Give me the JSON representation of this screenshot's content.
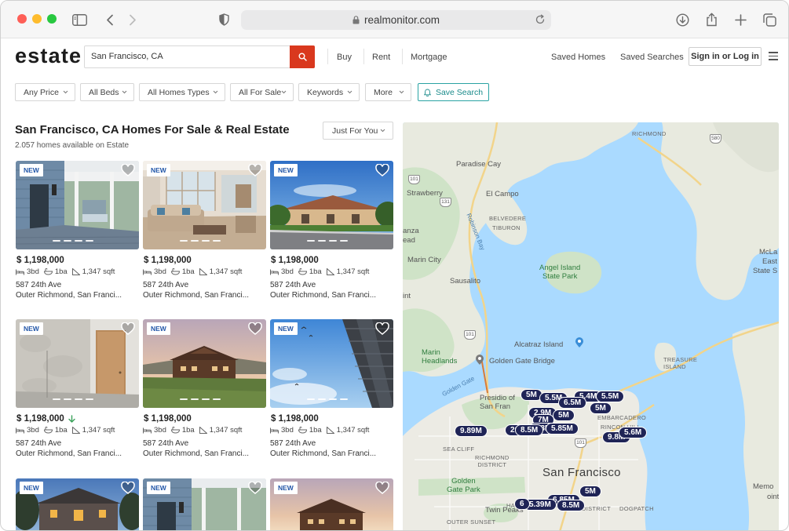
{
  "browser": {
    "url": "realmonitor.com"
  },
  "site": {
    "logo": "estate",
    "search_value": "San Francisco, CA",
    "nav": [
      "Buy",
      "Rent",
      "Mortgage"
    ],
    "saved_homes": "Saved Homes",
    "saved_searches": "Saved Searches",
    "sign_in": "Sign in or Log in"
  },
  "filters": [
    "Any Price",
    "All Beds",
    "All Homes Types",
    "All For Sale",
    "Keywords",
    "More"
  ],
  "save_search": "Save Search",
  "results": {
    "title": "San Francisco, CA Homes For Sale & Real Estate",
    "count_text": "2.057 homes available on Estate",
    "sort": "Just For You"
  },
  "listings": [
    {
      "badge": "NEW",
      "price": "$ 1,198,000",
      "beds": "3bd",
      "baths": "1ba",
      "sqft": "1,347 sqft",
      "address": "587 24th Ave",
      "area": "Outer Richmond, San Franci...",
      "price_drop": false
    },
    {
      "badge": "NEW",
      "price": "$ 1,198,000",
      "beds": "3bd",
      "baths": "1ba",
      "sqft": "1,347 sqft",
      "address": "587 24th Ave",
      "area": "Outer Richmond, San Franci...",
      "price_drop": false
    },
    {
      "badge": "NEW",
      "price": "$ 1,198,000",
      "beds": "3bd",
      "baths": "1ba",
      "sqft": "1,347 sqft",
      "address": "587 24th Ave",
      "area": "Outer Richmond, San Franci...",
      "price_drop": false
    },
    {
      "badge": "NEW",
      "price": "$ 1,198,000",
      "beds": "3bd",
      "baths": "1ba",
      "sqft": "1,347 sqft",
      "address": "587 24th Ave",
      "area": "Outer Richmond, San Franci...",
      "price_drop": true
    },
    {
      "badge": "NEW",
      "price": "$ 1,198,000",
      "beds": "3bd",
      "baths": "1ba",
      "sqft": "1,347 sqft",
      "address": "587 24th Ave",
      "area": "Outer Richmond, San Franci...",
      "price_drop": false
    },
    {
      "badge": "NEW",
      "price": "$ 1,198,000",
      "beds": "3bd",
      "baths": "1ba",
      "sqft": "1,347 sqft",
      "address": "587 24th Ave",
      "area": "Outer Richmond, San Franci...",
      "price_drop": false
    },
    {
      "badge": "NEW"
    },
    {
      "badge": "NEW"
    },
    {
      "badge": "NEW"
    }
  ],
  "map": {
    "places": {
      "richmond": "RICHMOND",
      "paradise_cay": "Paradise Cay",
      "strawberry": "Strawberry",
      "el_campo": "El Campo",
      "belvedere": "BELVEDERE",
      "tiburon": "TIBURON",
      "anza": "anza",
      "read": "ead",
      "marin_city": "Marin City",
      "angel_island": "Angel Island\nState Park",
      "sausalito": "Sausalito",
      "mcla1": "McLa",
      "mcla2": "East",
      "mcla3": "State S",
      "marin_headlands": "Marin\nHeadlands",
      "golden_gate_bridge": "Golden Gate Bridge",
      "alcatraz": "Alcatraz Island",
      "treasure": "TREASURE\nISLAND",
      "golden_gate": "Golden Gate",
      "presidio": "Presidio of\nSan Fran",
      "embarcadero": "EMBARCADERO",
      "rincon": "RINCON HILL",
      "sea_cliff": "SEA CLIFF",
      "richmond_district": "RICHMOND\nDISTRICT",
      "san_francisco": "San Francisco",
      "gg_park": "Golden\nGate Park",
      "haight": "HAIGHT-ASHBURY",
      "twin_peaks": "Twin Peaks",
      "sunset": "OUTER SUNSET",
      "mission": "DISTRICT",
      "dogpatch": "DOGPATCH",
      "memo": "Memo",
      "point": "oint",
      "robinson_bay": "Robinson Bay",
      "int": "int"
    },
    "shields": [
      "580",
      "101",
      "131",
      "101",
      "101"
    ],
    "pins": [
      "5M",
      "5.5M",
      "5.4M",
      "5.5M",
      "5M",
      "6.5M",
      "2.9M",
      "7M",
      "5M",
      "6.8M",
      "5.85M",
      "20",
      "8.5M",
      "9.89M",
      "9.8M",
      "5.6M",
      "5M",
      "6.85M",
      "5.39M",
      "8.5M",
      "6"
    ]
  },
  "colors": {
    "accent_red": "#d9381e",
    "teal": "#2aa3a3",
    "pin": "#1f2456",
    "badge_text": "#2357a8"
  }
}
